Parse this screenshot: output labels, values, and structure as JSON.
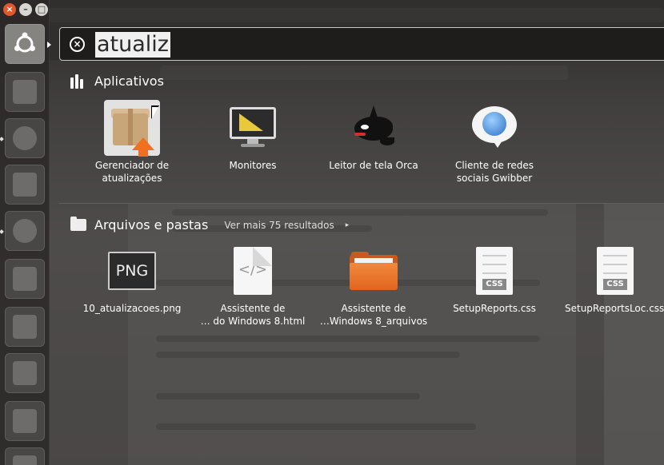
{
  "window_controls": {
    "close_glyph": "×",
    "minimize_glyph": "–",
    "maximize_glyph": "□"
  },
  "launcher": {
    "items": [
      {
        "name": "dash-home-icon"
      },
      {
        "name": "screenshot-camera-icon"
      },
      {
        "name": "chromium-browser-icon"
      },
      {
        "name": "files-folder-icon"
      },
      {
        "name": "firefox-browser-icon"
      },
      {
        "name": "libreoffice-writer-icon"
      },
      {
        "name": "libreoffice-calc-icon"
      },
      {
        "name": "libreoffice-impress-icon"
      },
      {
        "name": "software-center-icon"
      },
      {
        "name": "workspace-switcher-icon"
      }
    ]
  },
  "search": {
    "clear_glyph": "×",
    "query": "atualiz"
  },
  "sections": {
    "applications": {
      "title": "Aplicativos",
      "items": [
        {
          "label_line1": "Gerenciador de",
          "label_line2": "atualizações",
          "icon": "update-manager-icon"
        },
        {
          "label_line1": "Monitores",
          "label_line2": "",
          "icon": "displays-monitor-icon"
        },
        {
          "label_line1": "Leitor de tela Orca",
          "label_line2": "",
          "icon": "orca-screen-reader-icon"
        },
        {
          "label_line1": "Cliente de redes",
          "label_line2": "sociais Gwibber",
          "icon": "gwibber-globe-icon"
        }
      ]
    },
    "files": {
      "title": "Arquivos e pastas",
      "more_link": "Ver mais 75 resultados",
      "more_arrow": "▸",
      "items": [
        {
          "label_line1": "10_atualizacoes.png",
          "label_line2": "",
          "icon": "png-image-icon",
          "icon_text": "PNG"
        },
        {
          "label_line1": "Assistente de",
          "label_line2": "… do Windows 8.html",
          "icon": "html-document-icon",
          "icon_text": "</>"
        },
        {
          "label_line1": "Assistente de",
          "label_line2": "…Windows 8_arquivos",
          "icon": "orange-folder-icon"
        },
        {
          "label_line1": "SetupReports.css",
          "label_line2": "",
          "icon": "css-file-icon",
          "icon_text": "CSS"
        },
        {
          "label_line1": "SetupReportsLoc.css",
          "label_line2": "",
          "icon": "css-file-icon",
          "icon_text": "CSS"
        }
      ]
    }
  }
}
